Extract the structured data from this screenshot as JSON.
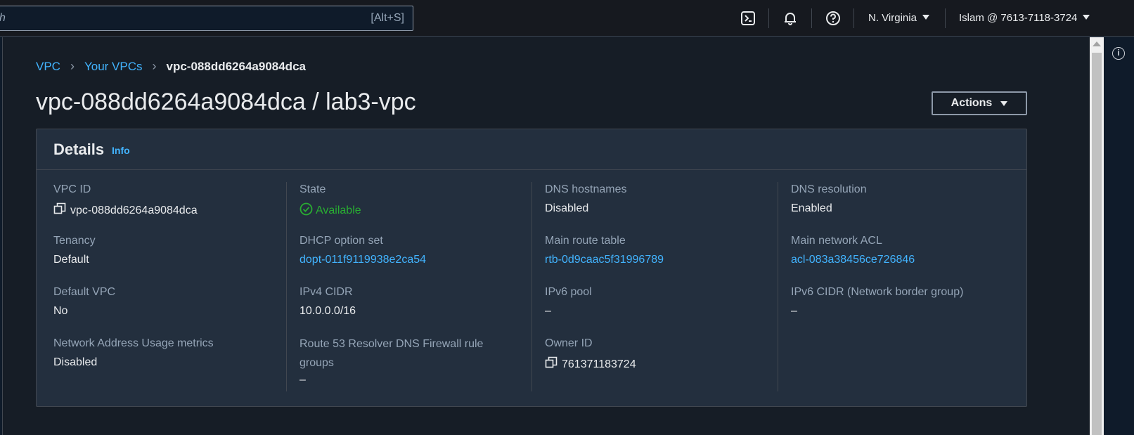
{
  "topbar": {
    "search_text": "h",
    "search_shortcut": "[Alt+S]",
    "region": "N. Virginia",
    "account": "Islam @ 7613-7118-3724"
  },
  "breadcrumb": {
    "items": [
      "VPC",
      "Your VPCs"
    ],
    "current": "vpc-088dd6264a9084dca"
  },
  "page_title": "vpc-088dd6264a9084dca / lab3-vpc",
  "actions_label": "Actions",
  "details": {
    "title": "Details",
    "info": "Info",
    "fields": {
      "vpc_id": {
        "label": "VPC ID",
        "value": "vpc-088dd6264a9084dca"
      },
      "state": {
        "label": "State",
        "value": "Available"
      },
      "dns_hostnames": {
        "label": "DNS hostnames",
        "value": "Disabled"
      },
      "dns_resolution": {
        "label": "DNS resolution",
        "value": "Enabled"
      },
      "tenancy": {
        "label": "Tenancy",
        "value": "Default"
      },
      "dhcp": {
        "label": "DHCP option set",
        "value": "dopt-011f9119938e2ca54"
      },
      "main_route_table": {
        "label": "Main route table",
        "value": "rtb-0d9caac5f31996789"
      },
      "main_network_acl": {
        "label": "Main network ACL",
        "value": "acl-083a38456ce726846"
      },
      "default_vpc": {
        "label": "Default VPC",
        "value": "No"
      },
      "ipv4_cidr": {
        "label": "IPv4 CIDR",
        "value": "10.0.0.0/16"
      },
      "ipv6_pool": {
        "label": "IPv6 pool",
        "value": "–"
      },
      "ipv6_cidr": {
        "label": "IPv6 CIDR (Network border group)",
        "value": "–"
      },
      "nau_metrics": {
        "label": "Network Address Usage metrics",
        "value": "Disabled"
      },
      "route53": {
        "label": "Route 53 Resolver DNS Firewall rule groups",
        "value": "–"
      },
      "owner_id": {
        "label": "Owner ID",
        "value": "761371183724"
      }
    }
  },
  "colors": {
    "link": "#42b4ff",
    "success": "#29ad32",
    "panel": "#232f3e",
    "background": "#161d26"
  }
}
